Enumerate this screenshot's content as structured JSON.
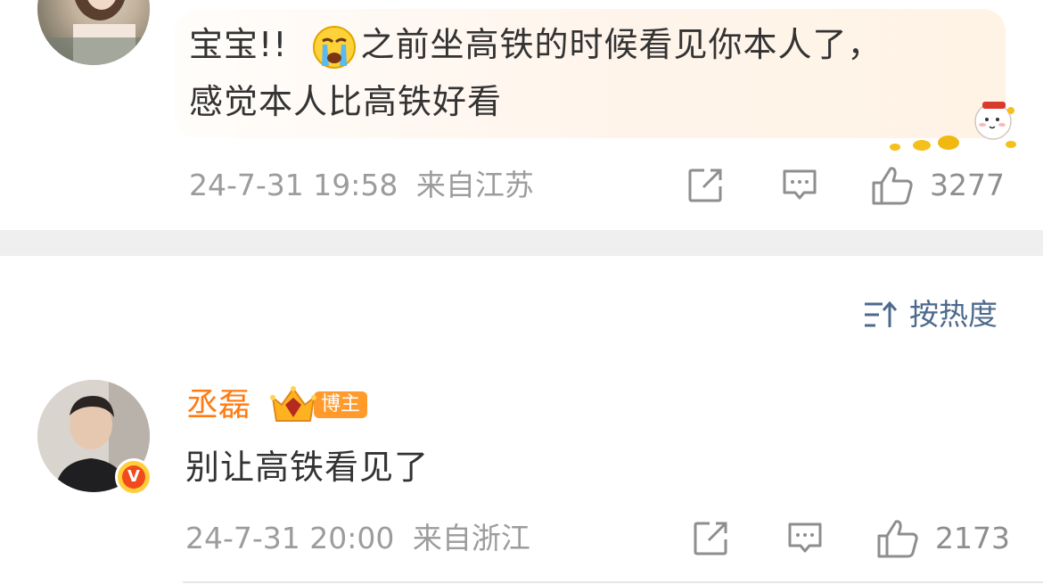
{
  "comment1": {
    "text_part1": "宝宝!!",
    "emoji_name": "crying-face-icon",
    "text_part2": "之前坐高铁的时候看见你本人了，",
    "text_line2": "感觉本人比高铁好看",
    "time": "24-7-31 19:58",
    "location": "来自江苏",
    "likes": "3277"
  },
  "sort": {
    "label": "按热度"
  },
  "comment2": {
    "username": "丞磊",
    "badge_label": "博主",
    "text": "别让高铁看见了",
    "time": "24-7-31 20:00",
    "location": "来自浙江",
    "likes": "2173",
    "verified_letter": "V"
  },
  "colors": {
    "username": "#ff7b12",
    "sort": "#4d6a8e",
    "meta": "#9c9c9c",
    "divider": "#efefef"
  }
}
